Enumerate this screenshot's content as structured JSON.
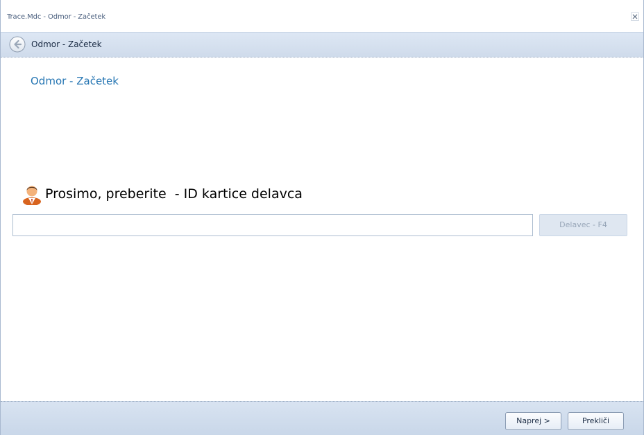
{
  "window": {
    "title": "Trace.Mdc - Odmor - Začetek"
  },
  "navbar": {
    "title": "Odmor - Začetek"
  },
  "main": {
    "heading": "Odmor - Začetek",
    "prompt": "Prosimo, preberite  - ID kartice delavca",
    "id_input": {
      "value": "",
      "placeholder": ""
    },
    "worker_button_label": "Delavec - F4"
  },
  "footer": {
    "next_label": "Naprej >",
    "cancel_label": "Prekliči"
  },
  "icons": {
    "close": "close-icon",
    "back": "back-arrow-icon",
    "user": "user-icon"
  },
  "colors": {
    "accent": "#2676b3",
    "nav_bg": "#d5e0ef"
  }
}
